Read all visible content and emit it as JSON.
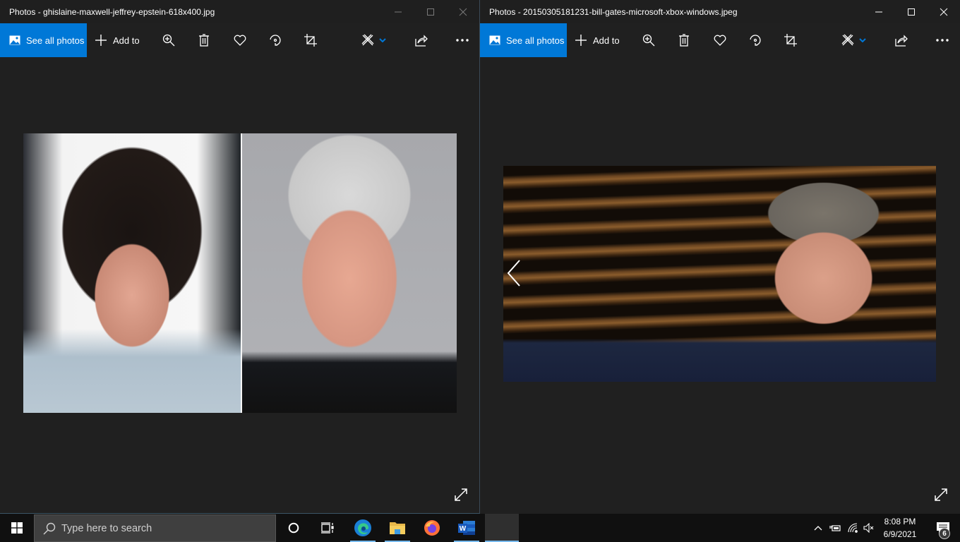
{
  "windows": [
    {
      "title": "Photos - ghislaine-maxwell-jeffrey-epstein-618x400.jpg",
      "state": "inactive",
      "photo_alt": "Side-by-side portraits: woman with dark hair and red earrings; grey-haired man on grey background"
    },
    {
      "title": "Photos - 20150305181231-bill-gates-microsoft-xbox-windows.jpeg",
      "state": "active",
      "photo_alt": "Smiling man in glasses before striped wooden wall"
    }
  ],
  "toolbar": {
    "see_all_photos": "See all photos",
    "add_to": "Add to",
    "icons": [
      "zoom-icon",
      "delete-icon",
      "favorite-icon",
      "rotate-icon",
      "crop-icon",
      "edit-create-icon",
      "share-icon",
      "more-icon"
    ]
  },
  "taskbar": {
    "search_placeholder": "Type here to search",
    "apps": [
      "Cortana",
      "Task View",
      "Microsoft Edge",
      "File Explorer",
      "Firefox",
      "Microsoft Word",
      "Photos"
    ],
    "time": "8:08 PM",
    "date": "6/9/2021",
    "notification_count": "6"
  },
  "colors": {
    "accent": "#0078d7",
    "background": "#202020",
    "taskbar": "#101010",
    "edit_chevron": "#0078d7"
  }
}
